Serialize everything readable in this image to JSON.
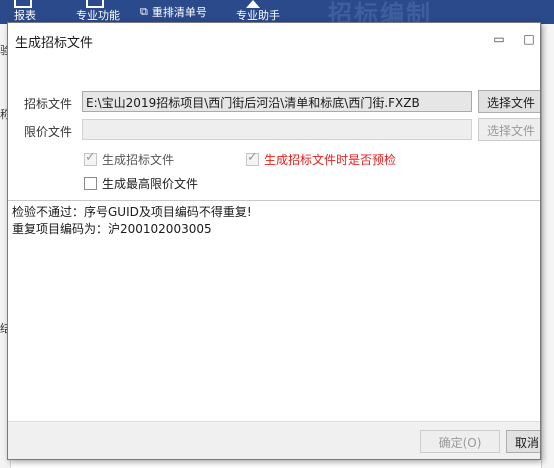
{
  "background": {
    "ribbon": [
      {
        "label": "报表"
      },
      {
        "label": "专业功能"
      },
      {
        "label": "重排清单号"
      },
      {
        "label": "专业助手"
      }
    ],
    "watermark": "招标编制",
    "left_chars": [
      "验",
      "称",
      "结"
    ]
  },
  "dialog": {
    "title": "生成招标文件",
    "minimize_glyph": "▭",
    "maximize_glyph": "□",
    "bid_file": {
      "label": "招标文件",
      "value": "E:\\宝山2019招标项目\\西门街后河沿\\清单和标底\\西门街.FXZB",
      "button": "选择文件"
    },
    "limit_file": {
      "label": "限价文件",
      "value": "",
      "button": "选择文件"
    },
    "options": {
      "gen_bid": {
        "label": "生成招标文件",
        "checked": true
      },
      "precheck": {
        "label": "生成招标文件时是否预检",
        "checked": true
      },
      "gen_limit": {
        "label": "生成最高限价文件",
        "checked": false
      }
    },
    "log_lines": [
      "检验不通过：序号GUID及项目编码不得重复!",
      "重复项目编码为：沪200102003005"
    ],
    "footer": {
      "ok": "确定(O)",
      "cancel": "取消"
    }
  }
}
